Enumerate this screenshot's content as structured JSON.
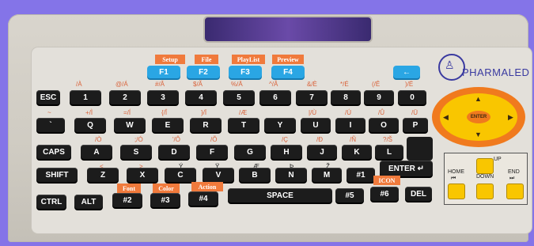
{
  "function_keys": [
    {
      "tag": "Setup",
      "label": "F1"
    },
    {
      "tag": "File",
      "label": "F2"
    },
    {
      "tag": "PlayList",
      "label": "F3"
    },
    {
      "tag": "Preview",
      "label": "F4"
    }
  ],
  "back_key": "←",
  "logo": "PHARMALED",
  "row1": [
    "ESC",
    "1",
    "2",
    "3",
    "4",
    "5",
    "6",
    "7",
    "8",
    "9",
    "0"
  ],
  "row1_acc": [
    "/À",
    "@/Á",
    "#/Â",
    "$/Ã",
    "%/Ä",
    "^/Å",
    "&/È",
    "*/É",
    "(/Ê",
    ")/Ë"
  ],
  "row2": [
    "`",
    "Q",
    "W",
    "E",
    "R",
    "T",
    "Y",
    "U",
    "I",
    "O",
    "P"
  ],
  "row2_acc": [
    "~",
    "+/Ì",
    "=/Í",
    "{/Î",
    "}/Ï",
    "/Æ",
    "|/Ù",
    "/Ú",
    "/Û",
    "/Ü"
  ],
  "row3": [
    "CAPS",
    "A",
    "S",
    "D",
    "F",
    "G",
    "H",
    "J",
    "K",
    "L"
  ],
  "row3_acc": [
    "/Ò",
    ";/Ó",
    "'/Ô",
    "/Õ",
    "/Ç",
    "/Ð",
    "/Ñ",
    "?/Š"
  ],
  "row4": [
    "SHIFT",
    "Z",
    "X",
    "C",
    "V",
    "B",
    "N",
    "M",
    "#1"
  ],
  "row4_acc": [
    "<",
    ">",
    "Ý",
    "Ÿ",
    "Æ",
    "Þ",
    "Ž"
  ],
  "enter": "ENTER",
  "row5": [
    "CTRL",
    "ALT",
    "#2",
    "#3",
    "#4",
    "SPACE",
    "#5",
    "#6",
    "DEL"
  ],
  "row5_tags": {
    "font": "Font",
    "color": "Color",
    "action": "Action",
    "icon": "ICON"
  },
  "dpad": {
    "enter": "ENTER",
    "up": "▲",
    "down": "▼",
    "left": "◀",
    "right": "▶"
  },
  "nav": {
    "home": "HOME",
    "up": "UP",
    "down": "DOWN",
    "end": "END",
    "home_glyph": "⏮",
    "end_glyph": "⏭"
  }
}
